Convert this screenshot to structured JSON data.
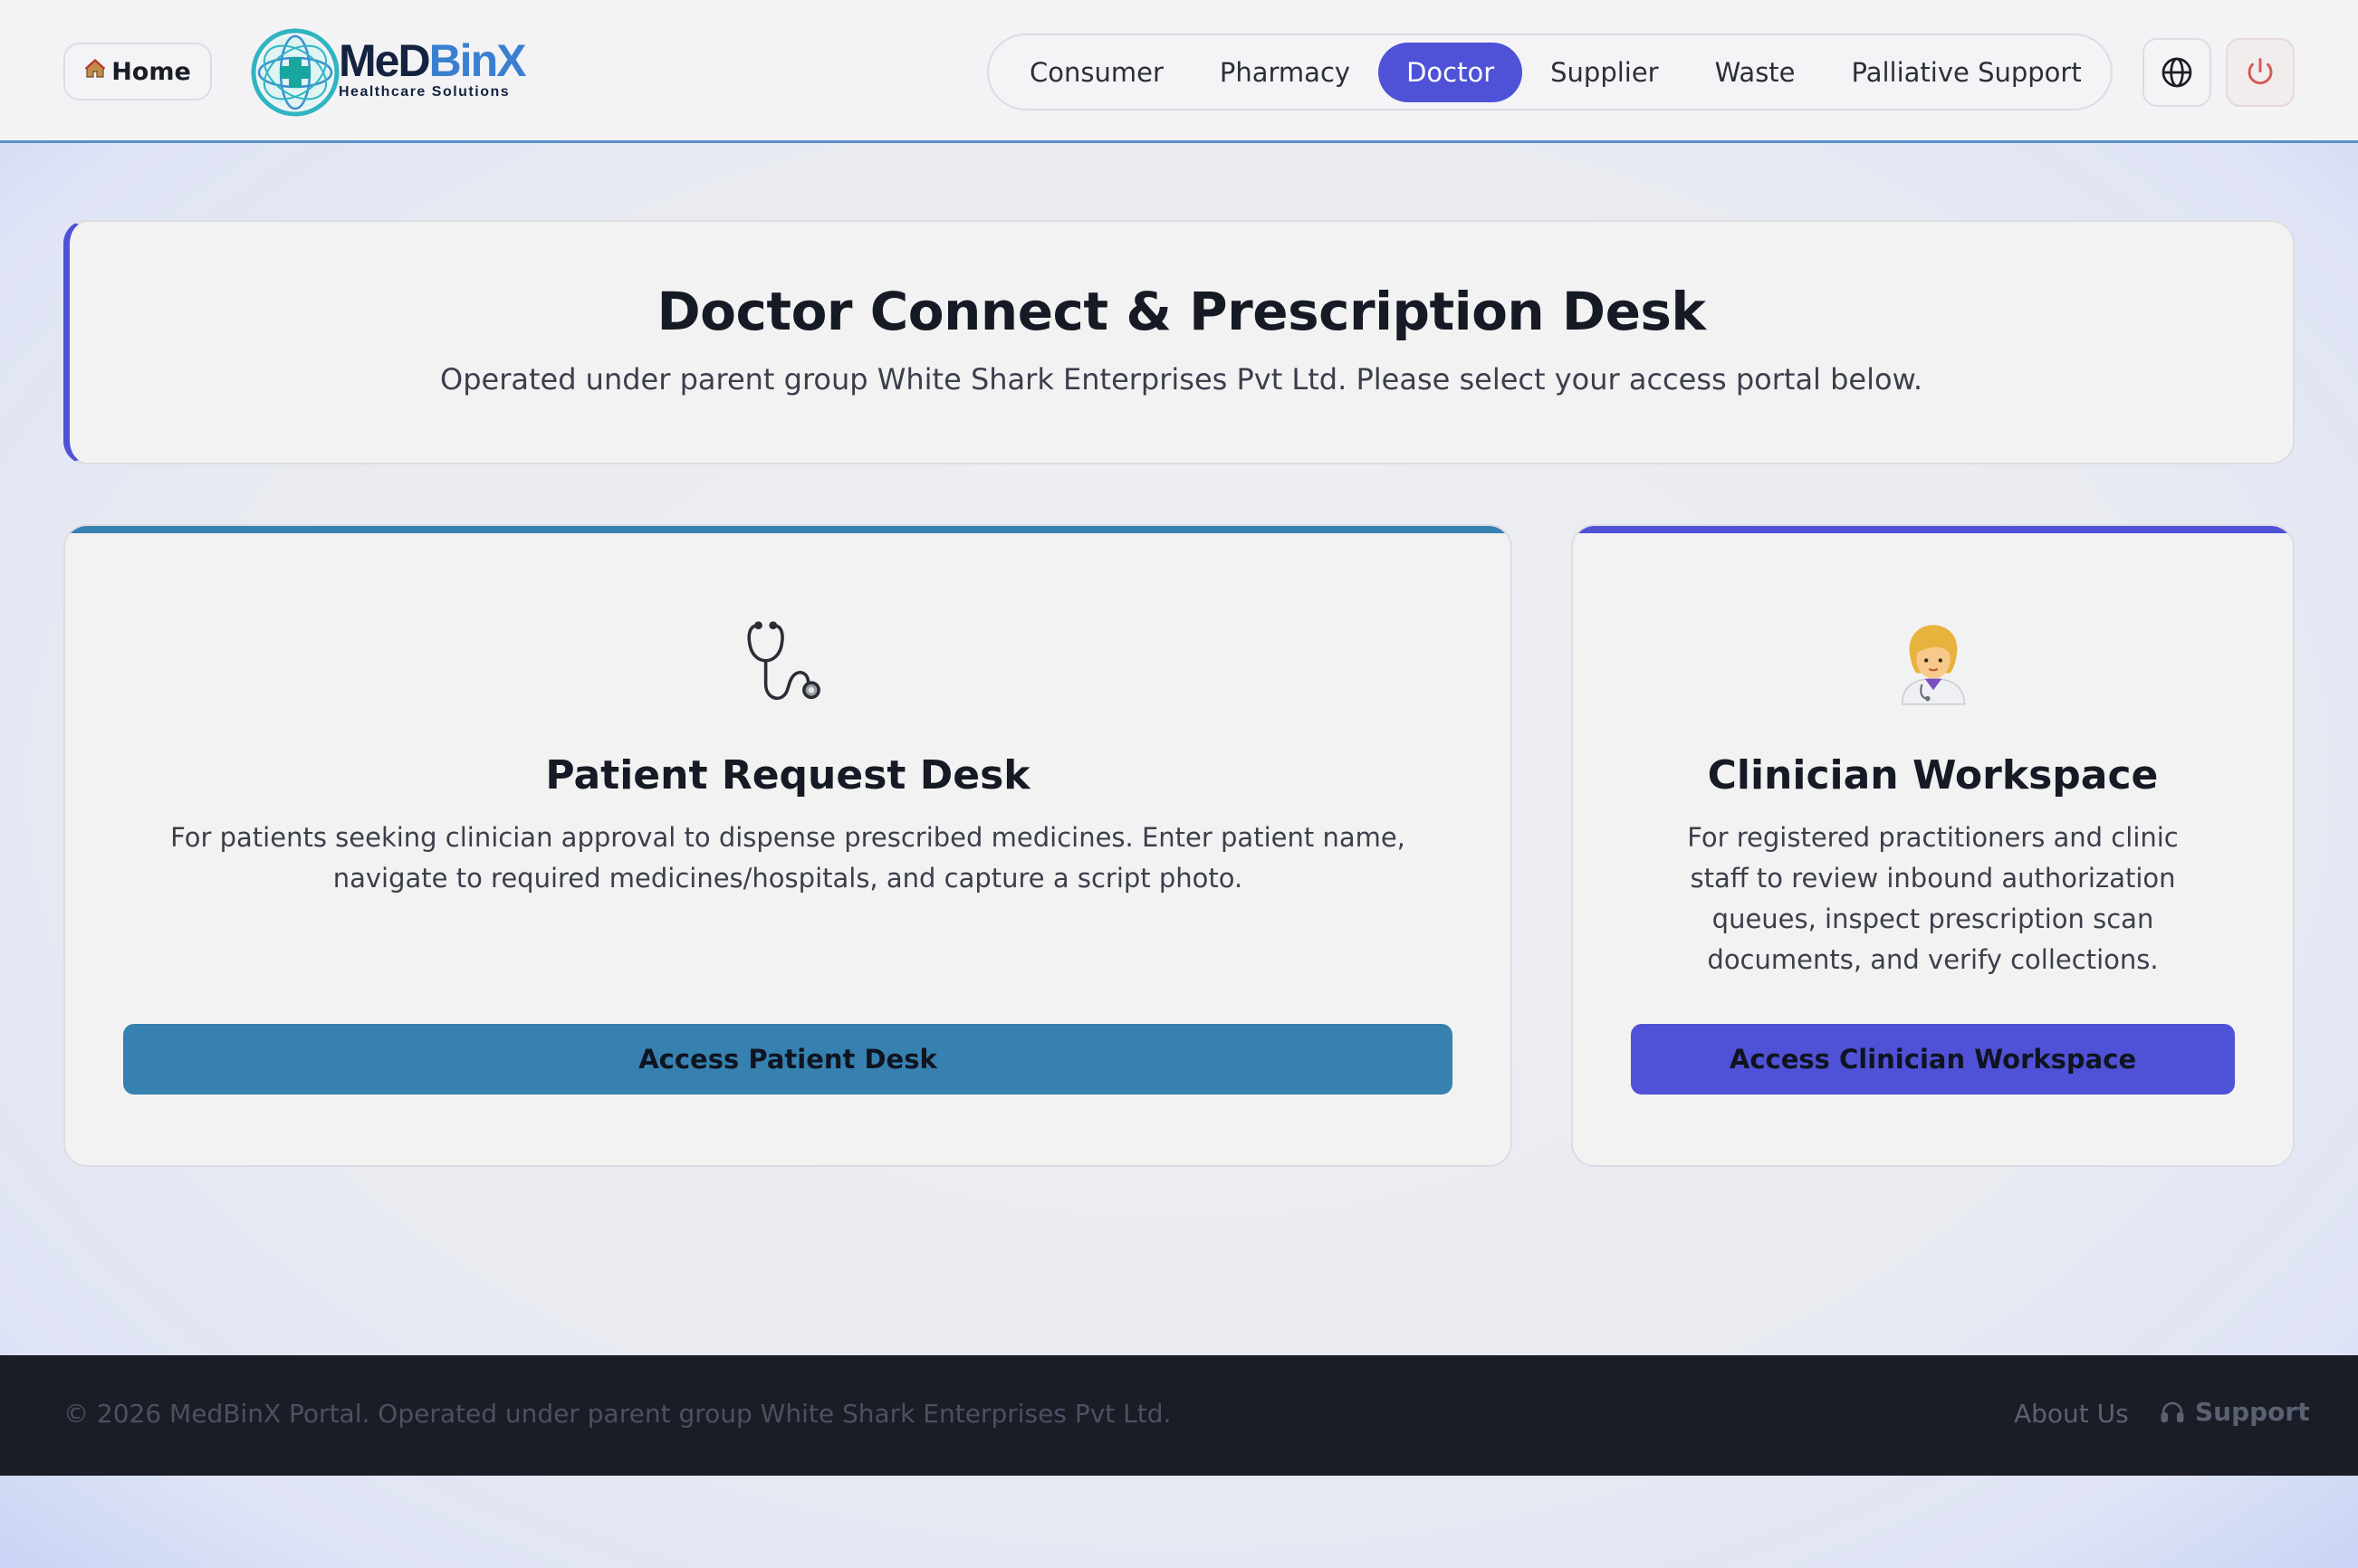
{
  "header": {
    "home_label": "Home",
    "home_icon": "house-icon",
    "logo": {
      "title_part1": "MeD",
      "title_part2": "BinX",
      "subtitle": "Healthcare Solutions"
    },
    "nav": [
      {
        "label": "Consumer",
        "active": false
      },
      {
        "label": "Pharmacy",
        "active": false
      },
      {
        "label": "Doctor",
        "active": true
      },
      {
        "label": "Supplier",
        "active": false
      },
      {
        "label": "Waste",
        "active": false
      },
      {
        "label": "Palliative Support",
        "active": false
      }
    ],
    "language_icon": "globe-icon",
    "logout_icon": "power-icon"
  },
  "hero": {
    "title": "Doctor Connect & Prescription Desk",
    "subtitle": "Operated under parent group White Shark Enterprises Pvt Ltd. Please select your access portal below."
  },
  "cards": {
    "patient": {
      "icon": "stethoscope-icon",
      "title": "Patient Request Desk",
      "description": "For patients seeking clinician approval to dispense prescribed medicines. Enter patient name, navigate to required medicines/hospitals, and capture a script photo.",
      "button_label": "Access Patient Desk"
    },
    "clinician": {
      "icon": "woman-health-worker-icon",
      "title": "Clinician Workspace",
      "description": "For registered practitioners and clinic staff to review inbound authorization queues, inspect prescription scan documents, and verify collections.",
      "button_label": "Access Clinician Workspace"
    }
  },
  "footer": {
    "copyright": "© 2026 MedBinX Portal. Operated under parent group White Shark Enterprises Pvt Ltd.",
    "about_label": "About Us",
    "support_label": "Support",
    "support_icon": "headset-icon"
  },
  "colors": {
    "accent": "#4f52d6",
    "patient_accent": "#3681b0",
    "header_border": "#5b8fc9",
    "footer_bg": "#1a1d26"
  }
}
